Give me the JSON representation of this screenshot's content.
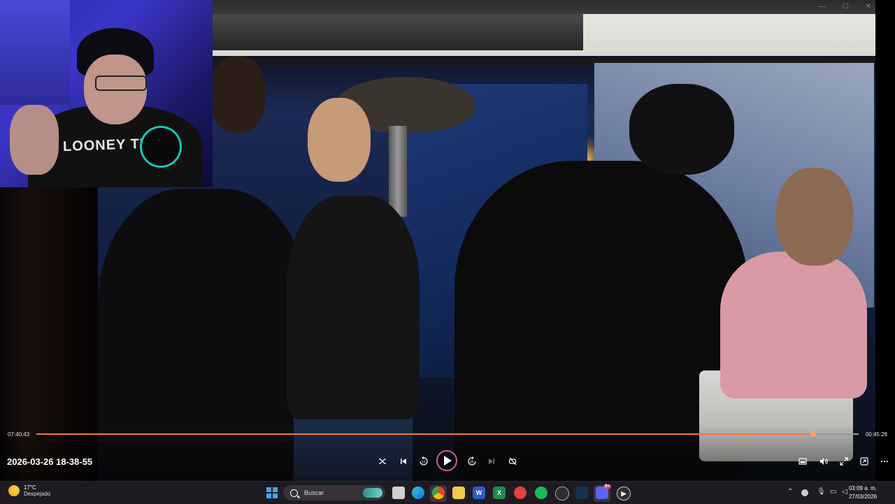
{
  "player": {
    "elapsed": "07:40:43",
    "remaining": "00:45:28",
    "progress": 0.9447,
    "title": "2026-03-26 18-38-55",
    "accent_color": "#f07a3a",
    "play_ring_color": "#e0569a"
  },
  "webcam": {
    "shirt_text": "LOONEY TUNES"
  },
  "taskbar": {
    "weather_temp": "17°C",
    "weather_desc": "Despejado",
    "search_placeholder": "Buscar",
    "clock_time": "03:09 a. m.",
    "clock_date": "27/03/2026",
    "discord_badge": "9+"
  },
  "icons": {
    "shuffle": "shuffle-icon",
    "previous": "previous-icon",
    "rewind": "rewind-10-icon",
    "play": "play-icon",
    "forward": "forward-30-icon",
    "next": "next-icon",
    "repeat": "repeat-icon",
    "miniplayer": "miniplayer-icon",
    "volume": "volume-icon",
    "fullscreen": "fullscreen-icon",
    "pip": "picture-in-picture-icon",
    "more": "more-icon"
  }
}
